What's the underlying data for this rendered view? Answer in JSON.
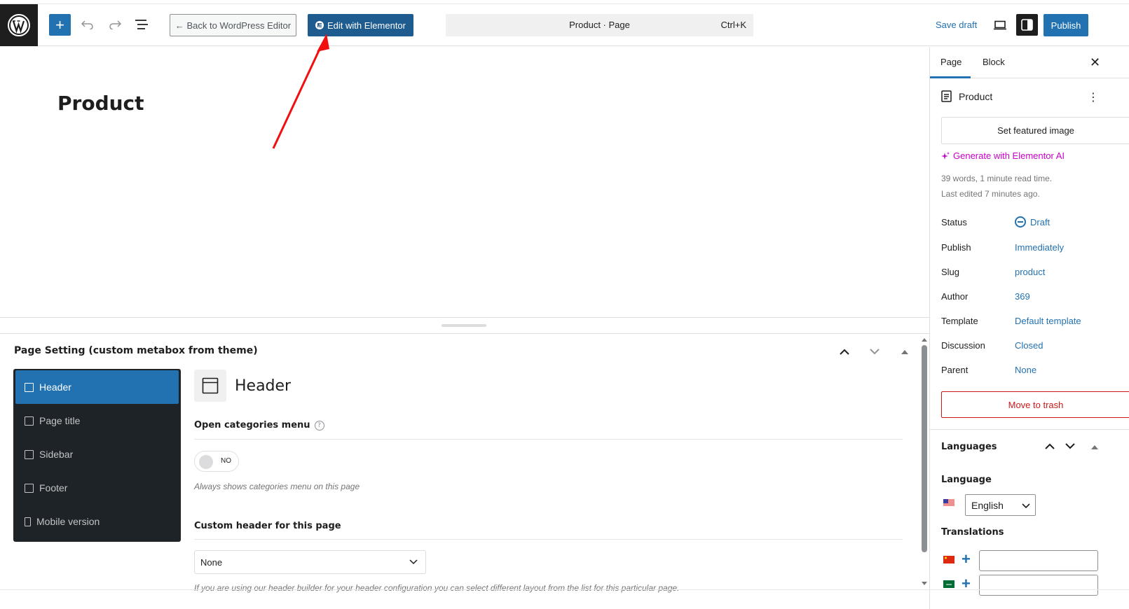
{
  "topbar": {
    "add_label": "+",
    "back_label": "← Back to WordPress Editor",
    "elementor_label": "Edit with Elementor",
    "command_title": "Product · Page",
    "command_shortcut": "Ctrl+K",
    "save_draft": "Save draft",
    "publish": "Publish"
  },
  "canvas": {
    "title": "Product"
  },
  "metabox": {
    "title": "Page Setting (custom metabox from theme)",
    "nav": [
      {
        "label": "Header",
        "icon": "layout-icon",
        "active": true
      },
      {
        "label": "Page title",
        "icon": "layout-icon"
      },
      {
        "label": "Sidebar",
        "icon": "sidebar-icon"
      },
      {
        "label": "Footer",
        "icon": "footer-icon"
      },
      {
        "label": "Mobile version",
        "icon": "mobile-icon"
      }
    ],
    "section_title": "Header",
    "field1_label": "Open categories menu",
    "field1_help": "?",
    "toggle_text": "NO",
    "field1_desc": "Always shows categories menu on this page",
    "field2_label": "Custom header for this page",
    "select_value": "None",
    "field2_desc": "If you are using our header builder for your header configuration you can select different layout from the list for this particular page."
  },
  "sidebar": {
    "tab_page": "Page",
    "tab_block": "Block",
    "doc_title": "Product",
    "featured_image": "Set featured image",
    "ai_link": "Generate with Elementor AI",
    "meta_words": "39 words, 1 minute read time.",
    "meta_edited": "Last edited 7 minutes ago.",
    "rows": [
      {
        "label": "Status",
        "value": "Draft"
      },
      {
        "label": "Publish",
        "value": "Immediately"
      },
      {
        "label": "Slug",
        "value": "product"
      },
      {
        "label": "Author",
        "value": "369"
      },
      {
        "label": "Template",
        "value": "Default template"
      },
      {
        "label": "Discussion",
        "value": "Closed"
      },
      {
        "label": "Parent",
        "value": "None"
      }
    ],
    "trash": "Move to trash",
    "languages_title": "Languages",
    "language_label": "Language",
    "language_value": "English",
    "translations_label": "Translations"
  },
  "colors": {
    "accent": "#2271b1",
    "elementor": "#1e5b8e",
    "ai": "#c800c8",
    "danger": "#cc1818",
    "nav_bg": "#1d2327"
  }
}
